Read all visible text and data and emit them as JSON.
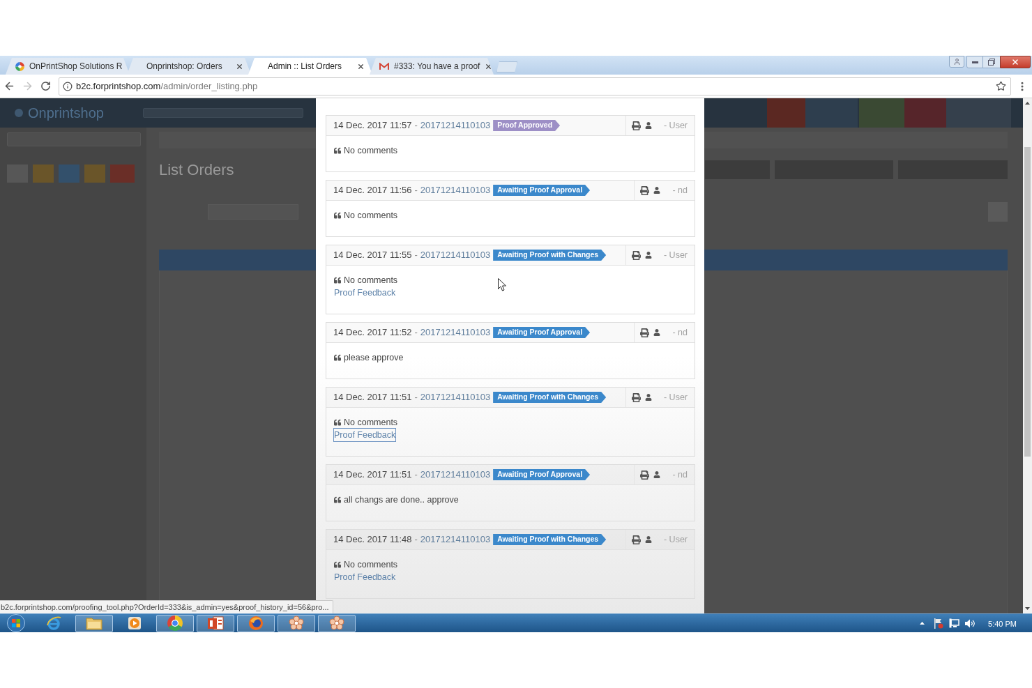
{
  "browser": {
    "tabs": [
      {
        "title": "OnPrintShop Solutions R",
        "kind": "site",
        "selected": false
      },
      {
        "title": "Onprintshop: Orders",
        "kind": "plain",
        "selected": false
      },
      {
        "title": "Admin :: List Orders",
        "kind": "plain",
        "selected": true
      },
      {
        "title": "#333: You have a proof",
        "kind": "mail",
        "selected": false
      }
    ],
    "navigation": {
      "back_disabled": false,
      "forward_disabled": true
    },
    "address": {
      "host": "b2c.forprintshop.com",
      "path": "/admin/order_listing.php"
    }
  },
  "background_page": {
    "logo": "Onprintshop",
    "title": "List Orders"
  },
  "proof_history": [
    {
      "datetime": "14 Dec. 2017 11:57",
      "separator": "-",
      "proof_no": "20171214110103",
      "status": {
        "label": "Proof Approved",
        "color": "#9d8fc6"
      },
      "author": "- User",
      "comment": "No comments"
    },
    {
      "datetime": "14 Dec. 2017 11:56",
      "separator": "-",
      "proof_no": "20171214110103",
      "status": {
        "label": "Awaiting Proof Approval",
        "color": "#3b88cb"
      },
      "author": "- nd",
      "comment": "No comments"
    },
    {
      "datetime": "14 Dec. 2017 11:55",
      "separator": "-",
      "proof_no": "20171214110103",
      "status": {
        "label": "Awaiting Proof with Changes",
        "color": "#3b88cb"
      },
      "author": "- User",
      "comment": "No comments",
      "link": {
        "label": "Proof Feedback",
        "focused": false
      }
    },
    {
      "datetime": "14 Dec. 2017 11:52",
      "separator": "-",
      "proof_no": "20171214110103",
      "status": {
        "label": "Awaiting Proof Approval",
        "color": "#3b88cb"
      },
      "author": "- nd",
      "comment": "please approve"
    },
    {
      "datetime": "14 Dec. 2017 11:51",
      "separator": "-",
      "proof_no": "20171214110103",
      "status": {
        "label": "Awaiting Proof with Changes",
        "color": "#3b88cb"
      },
      "author": "- User",
      "comment": "No comments",
      "link": {
        "label": "Proof Feedback",
        "focused": true
      }
    },
    {
      "datetime": "14 Dec. 2017 11:51",
      "separator": "-",
      "proof_no": "20171214110103",
      "status": {
        "label": "Awaiting Proof Approval",
        "color": "#3b88cb"
      },
      "author": "- nd",
      "comment": "all changs are done.. approve"
    },
    {
      "datetime": "14 Dec. 2017 11:48",
      "separator": "-",
      "proof_no": "20171214110103",
      "status": {
        "label": "Awaiting Proof with Changes",
        "color": "#3b88cb"
      },
      "author": "- User",
      "comment": "No comments",
      "link": {
        "label": "Proof Feedback",
        "focused": false
      }
    }
  ],
  "status_url": "b2c.forprintshop.com/proofing_tool.php?OrderId=333&is_admin=yes&proof_history_id=56&pro...",
  "taskbar": {
    "apps": [
      {
        "kind": "ie",
        "running": false
      },
      {
        "kind": "folder",
        "running": true
      },
      {
        "kind": "media",
        "running": false
      },
      {
        "kind": "chrome",
        "running": true
      },
      {
        "kind": "slides",
        "running": true
      },
      {
        "kind": "firefox",
        "running": true
      },
      {
        "kind": "flower",
        "running": true
      },
      {
        "kind": "flower",
        "running": true
      }
    ],
    "clock": "5:40 PM"
  }
}
